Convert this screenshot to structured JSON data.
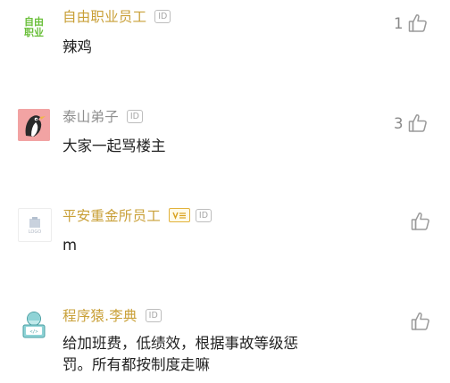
{
  "comments": [
    {
      "author": "自由职业员工",
      "id_badge": "ID",
      "avatar_text_line1": "自由",
      "avatar_text_line2": "职业",
      "text": "辣鸡",
      "likes": "1"
    },
    {
      "author": "泰山弟子",
      "id_badge": "ID",
      "text": "大家一起骂楼主",
      "likes": "3"
    },
    {
      "author": "平安重金所员工",
      "id_badge": "ID",
      "avatar_text": "LOGO",
      "text": "m",
      "likes": ""
    },
    {
      "author": "程序猿.李典",
      "id_badge": "ID",
      "text_line1": "给加班费，低绩效，根据事故等级惩",
      "text_line2": "罚。所有都按制度走嘛",
      "likes": ""
    }
  ],
  "colors": {
    "author_gold": "#c9a038",
    "author_gray": "#8e8e8e",
    "text": "#222222",
    "icon_gray": "#9a9a9a"
  }
}
